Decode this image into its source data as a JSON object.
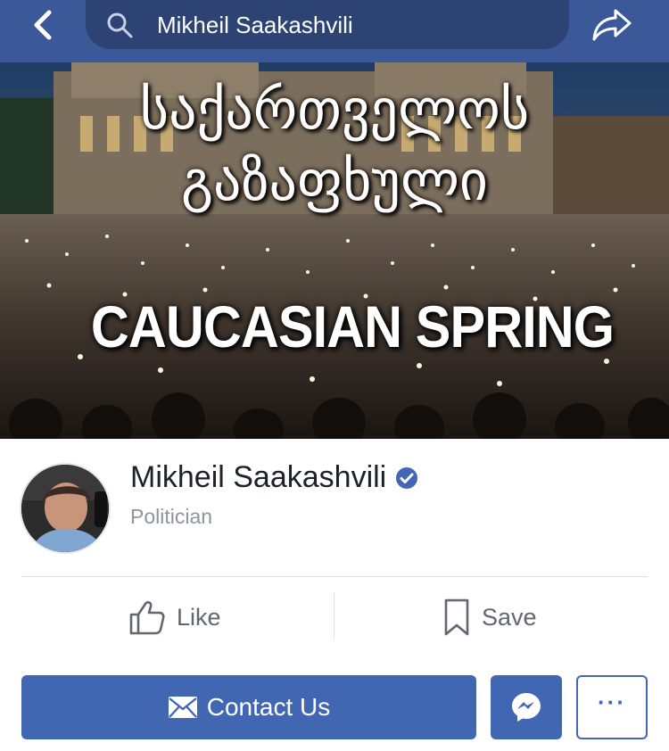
{
  "topbar": {
    "search_value": "Mikheil Saakashvili",
    "icons": {
      "back": "chevron-left-icon",
      "search": "search-icon",
      "share": "share-icon"
    }
  },
  "cover": {
    "title_line1": "საქართველოს",
    "title_line2": "გაზაფხული",
    "subtitle": "CAUCASIAN SPRING"
  },
  "profile": {
    "name": "Mikheil Saakashvili",
    "category": "Politician",
    "verified_icon": "verified-badge-icon"
  },
  "actions": {
    "like_label": "Like",
    "save_label": "Save"
  },
  "buttons": {
    "contact_label": "Contact Us",
    "more_label": "···"
  },
  "colors": {
    "brand": "#3b5998",
    "button_blue": "#4267b2",
    "verified": "#4267b2",
    "secondary_text": "#8d949e"
  }
}
